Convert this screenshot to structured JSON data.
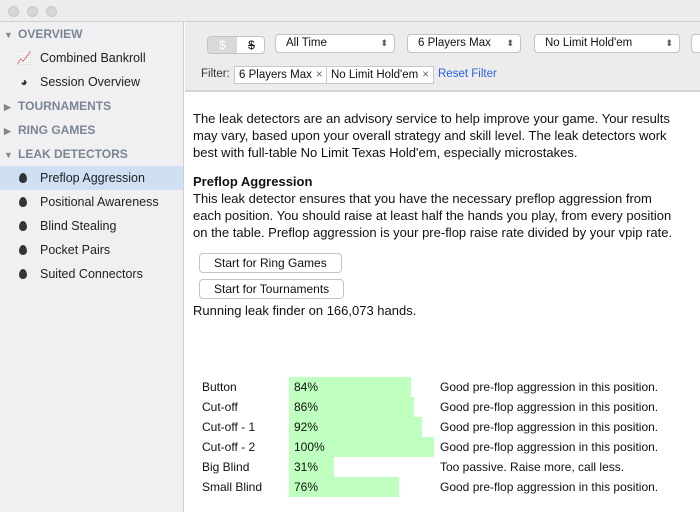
{
  "sidebar": {
    "sections": [
      {
        "label": "OVERVIEW",
        "expanded": true,
        "items": [
          {
            "label": "Combined Bankroll",
            "icon": "chart-icon"
          },
          {
            "label": "Session Overview",
            "icon": "dashboard-icon"
          }
        ]
      },
      {
        "label": "TOURNAMENTS",
        "expanded": false
      },
      {
        "label": "RING GAMES",
        "expanded": false
      },
      {
        "label": "LEAK DETECTORS",
        "expanded": true,
        "items": [
          {
            "label": "Preflop Aggression",
            "selected": true
          },
          {
            "label": "Positional Awareness"
          },
          {
            "label": "Blind Stealing"
          },
          {
            "label": "Pocket Pairs"
          },
          {
            "label": "Suited Connectors"
          }
        ]
      }
    ]
  },
  "toolbar": {
    "currency_dollar": "$",
    "currency_none": "$",
    "time": "All Time",
    "players": "6 Players Max",
    "game": "No Limit Hold'em",
    "filter_label": "Filter:",
    "chips": [
      "6 Players Max",
      "No Limit Hold'em"
    ],
    "chip_remove": "×",
    "reset": "Reset Filter"
  },
  "main": {
    "intro": "The leak detectors are an advisory service to help improve your game. Your results may vary, based upon your overall strategy and skill level. The leak detectors work best with full-table No Limit Texas Hold'em, especially microstakes.",
    "title": "Preflop Aggression",
    "desc": "This leak detector ensures that you have the necessary preflop aggression from each position. You should raise at least half the hands you play, from every position on the table. Preflop aggression is your pre-flop raise rate divided by your vpip rate.",
    "btn_ring": "Start for Ring Games",
    "btn_tourn": "Start for Tournaments",
    "status": "Running leak finder on 166,073 hands.",
    "bar_color": "#bfffbf",
    "rows": [
      {
        "position": "Button",
        "value": 84,
        "label": "84%",
        "message": "Good pre-flop aggression in this position."
      },
      {
        "position": "Cut-off",
        "value": 86,
        "label": "86%",
        "message": "Good pre-flop aggression in this position."
      },
      {
        "position": "Cut-off - 1",
        "value": 92,
        "label": "92%",
        "message": "Good pre-flop aggression in this position."
      },
      {
        "position": "Cut-off - 2",
        "value": 100,
        "label": "100%",
        "message": "Good pre-flop aggression in this position."
      },
      {
        "position": "Big Blind",
        "value": 31,
        "label": "31%",
        "message": "Too passive. Raise more, call less."
      },
      {
        "position": "Small Blind",
        "value": 76,
        "label": "76%",
        "message": "Good pre-flop aggression in this position."
      }
    ]
  }
}
